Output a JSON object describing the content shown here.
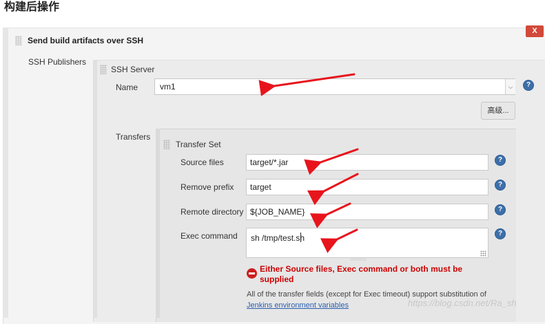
{
  "section_title": "构建后操作",
  "plugin": {
    "header": "Send build artifacts over SSH",
    "close_label": "X"
  },
  "ssh_publishers": {
    "label": "SSH Publishers",
    "server_header": "SSH Server",
    "name_label": "Name",
    "name_value": "vm1",
    "advanced_label": "高级...",
    "transfers_label": "Transfers"
  },
  "transfer_set": {
    "header": "Transfer Set",
    "source_files_label": "Source files",
    "source_files_value": "target/*.jar",
    "remove_prefix_label": "Remove prefix",
    "remove_prefix_value": "target",
    "remote_directory_label": "Remote directory",
    "remote_directory_value": "${JOB_NAME}",
    "exec_command_label": "Exec command",
    "exec_command_value": "sh /tmp/test.sh"
  },
  "validation": {
    "error_message": "Either Source files, Exec command or both must be supplied",
    "info_text": "All of the transfer fields (except for Exec timeout) support substitution of",
    "info_link": "Jenkins environment variables"
  },
  "help_icon_glyph": "?",
  "watermark": "https://blog.csdn.net/Ra_sh",
  "colors": {
    "annotation_arrow": "#e8141c",
    "error": "#cc0000",
    "link": "#2a5db0",
    "help_icon": "#3d6fa8",
    "close_button": "#d24939"
  }
}
